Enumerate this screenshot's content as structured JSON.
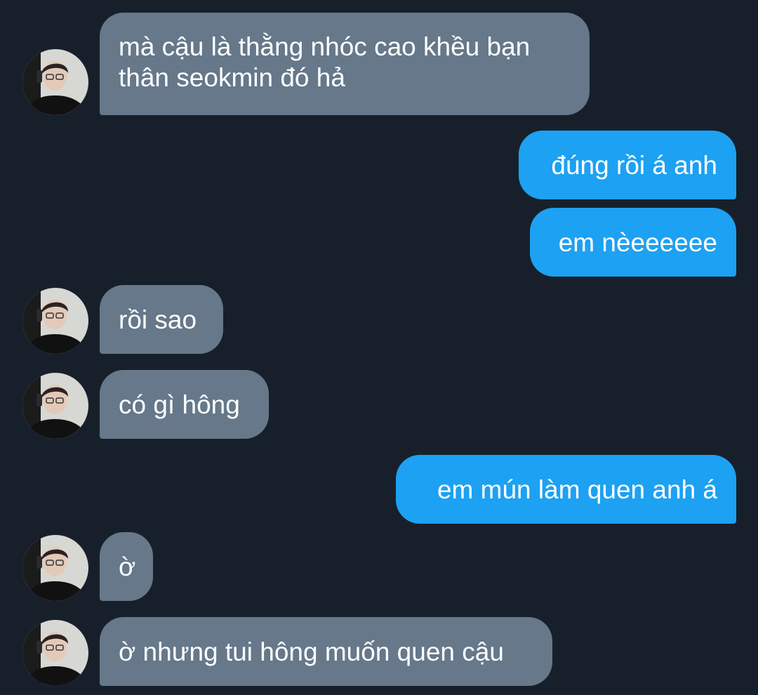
{
  "conversation": {
    "messages": [
      {
        "sender": "other",
        "text": "mà cậu là thằng nhóc cao khều bạn\nthân seokmin đó hả"
      },
      {
        "sender": "me",
        "text": "đúng rồi á anh"
      },
      {
        "sender": "me",
        "text": "em nèeeeeee"
      },
      {
        "sender": "other",
        "text": "rồi sao"
      },
      {
        "sender": "other",
        "text": "có gì hông"
      },
      {
        "sender": "me",
        "text": "em mún làm quen anh á"
      },
      {
        "sender": "other",
        "text": "ờ"
      },
      {
        "sender": "other",
        "text": "ờ nhưng tui hông muốn quen cậu"
      }
    ]
  },
  "colors": {
    "background": "#17202a",
    "incoming_bubble": "#66788a",
    "outgoing_bubble": "#1da1f2",
    "text": "#ffffff"
  }
}
